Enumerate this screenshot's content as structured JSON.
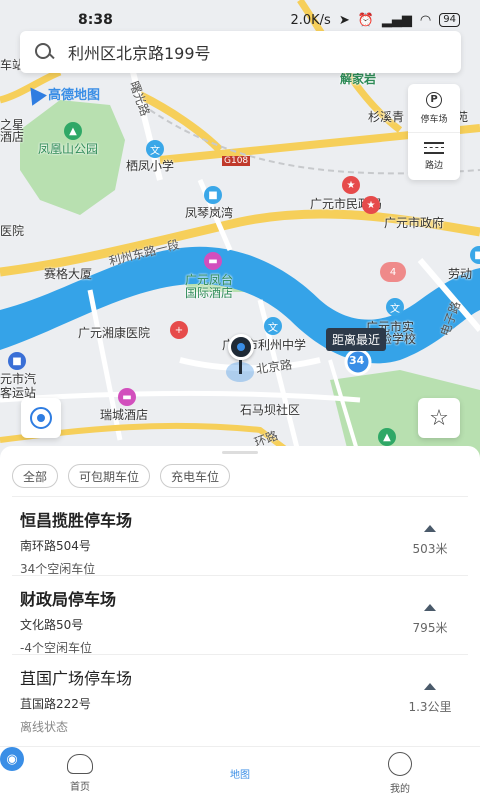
{
  "status_bar": {
    "time": "8:38",
    "net_speed": "2.0K/s",
    "battery": "94"
  },
  "search": {
    "text": "利州区北京路199号"
  },
  "map": {
    "logo": "高德地图",
    "labels": {
      "jiejia": "解家岩",
      "shanxi": "杉溪青",
      "fenghuang_park": "凤凰山公园",
      "qifeng_school": "栖凤小学",
      "zhixing": "之星",
      "hotel_left": "酒店",
      "g108": "G108",
      "fengqin": "凤琴岚湾",
      "minzheng": "广元市民政局",
      "zhengfu": "广元市政府",
      "yuan": "医院",
      "lizhou_road": "利州东路一段",
      "saige": "赛格大厦",
      "fengtai": "广元凤台",
      "fengtai2": "国际酒店",
      "laodong": "劳动",
      "xiangkang": "广元湘康医院",
      "lizhou_middle": "广元市利州中学",
      "shishi": "广元市实",
      "shishi2": "验学校",
      "beijing_road": "北京路",
      "qiche": "元市汽",
      "keyun": "客运站",
      "ruicheng": "瑞城酒店",
      "shimaba": "石马坝社区",
      "dianzi": "电子路",
      "huanlu": "环路",
      "chezhan": "车站",
      "shulu": "曙光路",
      "yuan_top": "苑"
    },
    "nearest_tag": "距离最近",
    "route_badge": "34",
    "side_buttons": [
      {
        "label": "停车场",
        "glyph": "P"
      },
      {
        "label": "路边",
        "glyph": ""
      }
    ],
    "fav_glyph": "☆"
  },
  "sheet": {
    "chips": [
      "全部",
      "可包期车位",
      "充电车位"
    ],
    "lots": [
      {
        "name": "恒昌揽胜停车场",
        "address": "南环路504号",
        "status": "34个空闲车位",
        "distance": "503米"
      },
      {
        "name": "财政局停车场",
        "address": "文化路50号",
        "status": "-4个空闲车位",
        "distance": "795米"
      },
      {
        "name": "苴国广场停车场",
        "address": "苴国路222号",
        "status": "离线状态",
        "distance": "1.3公里"
      }
    ]
  },
  "tab_bar": {
    "tabs": [
      {
        "label": "首页",
        "active": false
      },
      {
        "label": "地图",
        "active": true
      },
      {
        "label": "我的",
        "active": false
      }
    ]
  },
  "colors": {
    "accent": "#3a8ee6",
    "river": "#35a3e8",
    "park": "#a8d8a8",
    "road_major": "#f6cf5a"
  }
}
